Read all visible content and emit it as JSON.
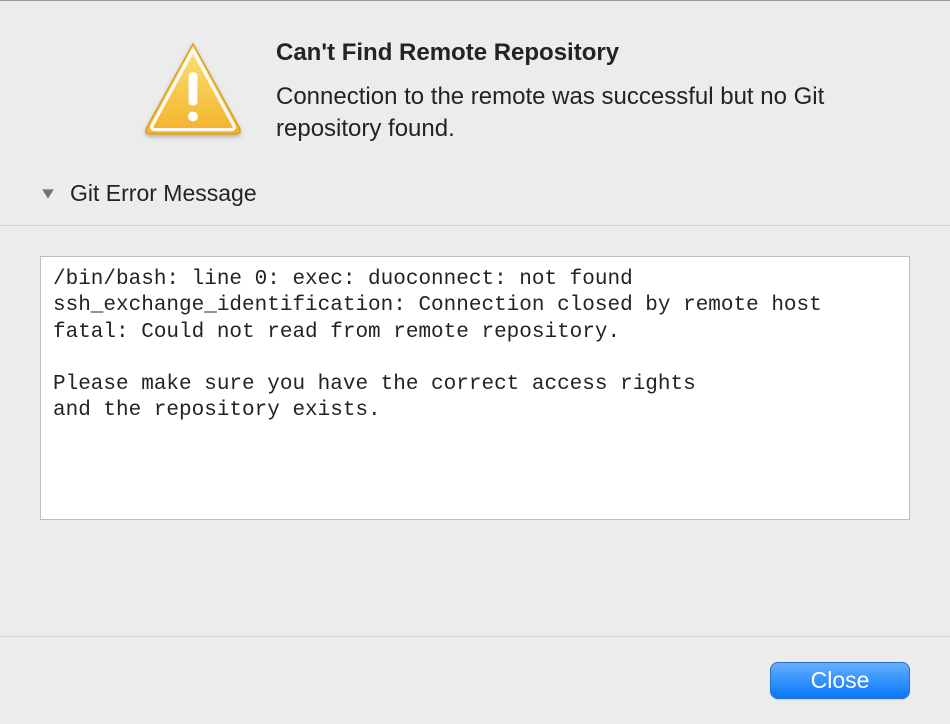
{
  "dialog": {
    "title": "Can't Find Remote Repository",
    "message": "Connection to the remote was successful but no Git repository found."
  },
  "disclosure": {
    "label": "Git Error Message"
  },
  "error": {
    "text": "/bin/bash: line 0: exec: duoconnect: not found\nssh_exchange_identification: Connection closed by remote host\nfatal: Could not read from remote repository.\n\nPlease make sure you have the correct access rights\nand the repository exists."
  },
  "footer": {
    "close_label": "Close"
  }
}
